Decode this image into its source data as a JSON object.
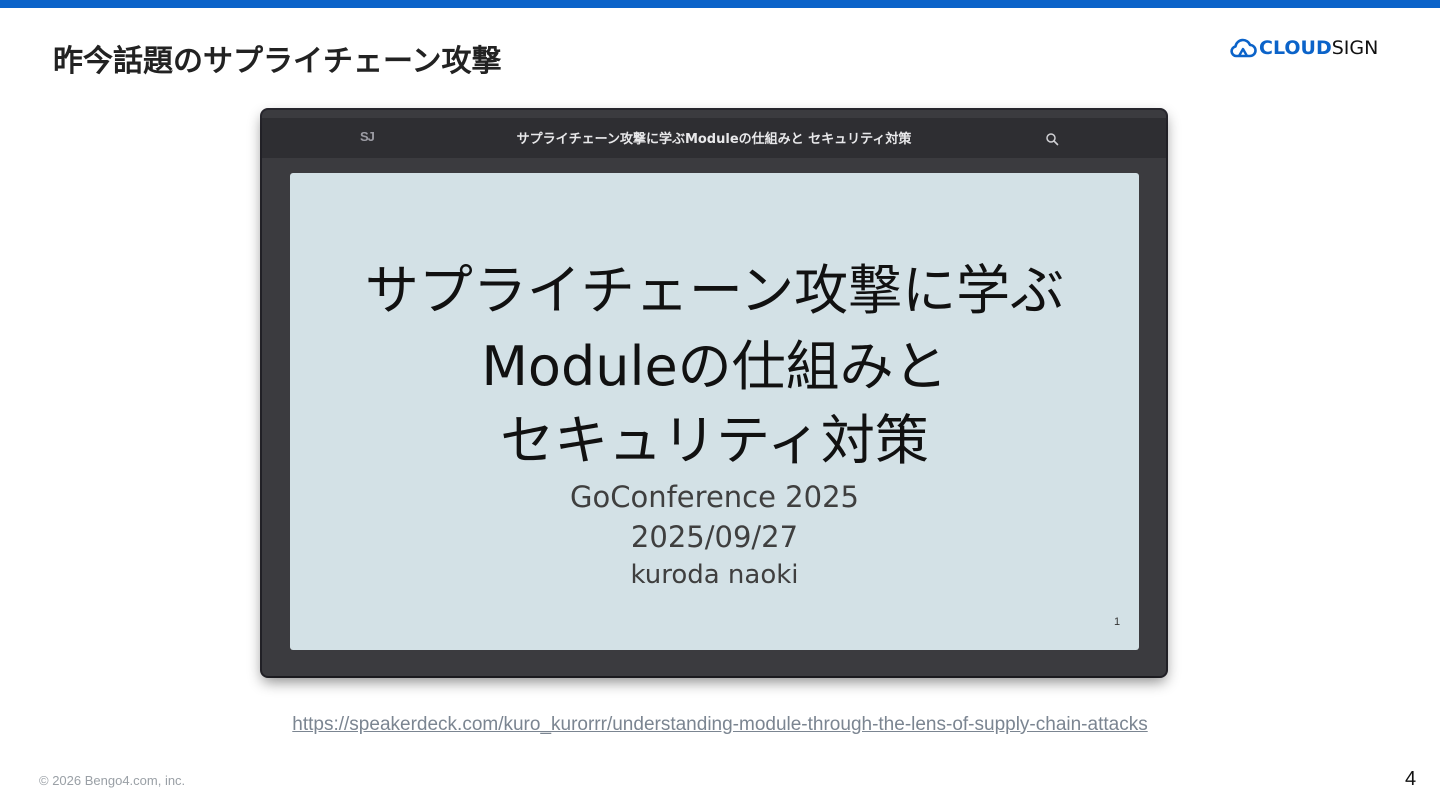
{
  "header": {
    "title": "昨今話題のサプライチェーン攻撃",
    "logo_icon": "cloud-icon",
    "logo_text_strong": "CLOUD",
    "logo_text_light": "SIGN",
    "accent_color": "#0b63c9"
  },
  "viewer": {
    "logo": "SJ",
    "title": "サプライチェーン攻撃に学ぶModuleの仕組みと セキュリティ対策",
    "search_icon": "search-icon",
    "slide": {
      "title_lines": [
        "サプライチェーン攻撃に学ぶ",
        "Moduleの仕組みと",
        "セキュリティ対策"
      ],
      "event": "GoConference 2025",
      "date": "2025/09/27",
      "author": "kuroda naoki",
      "page": "1"
    }
  },
  "source_url": "https://speakerdeck.com/kuro_kurorrr/understanding-module-through-the-lens-of-supply-chain-attacks",
  "footer": {
    "copyright": "© 2026 Bengo4.com, inc.",
    "page_number": "4"
  }
}
